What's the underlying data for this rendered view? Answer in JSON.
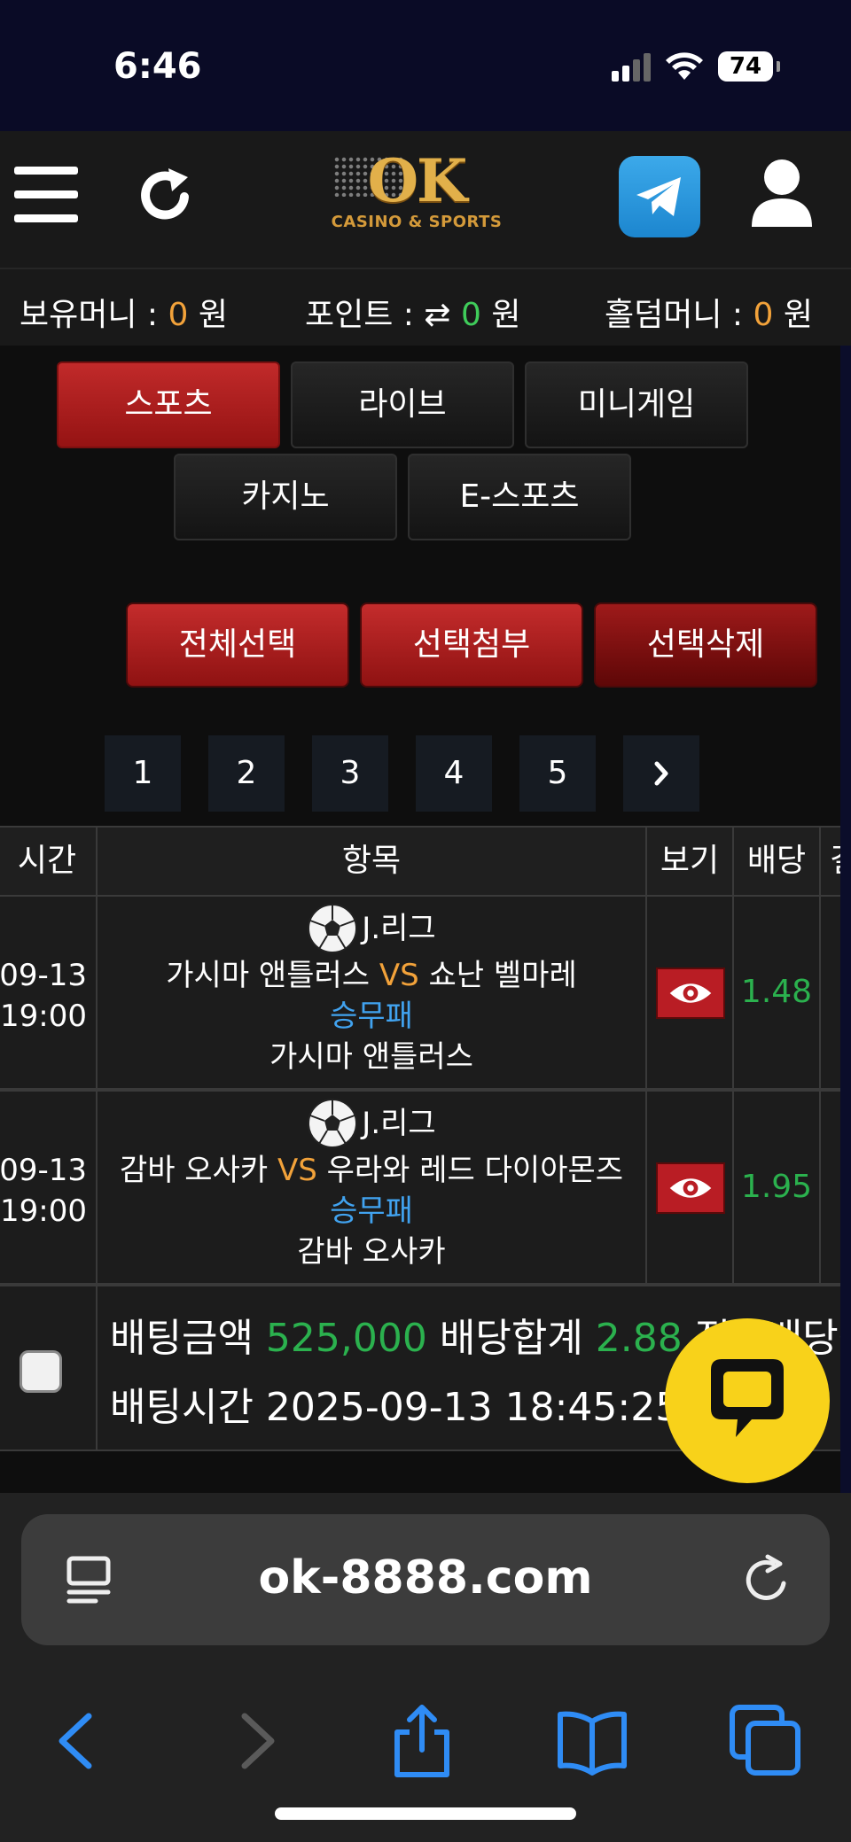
{
  "status": {
    "time": "6:46",
    "battery": "74"
  },
  "header": {
    "logo_main": "OK",
    "logo_sub": "CASINO & SPORTS"
  },
  "balance": {
    "money_label": "보유머니 :",
    "money_value": "0",
    "point_label": "포인트 :",
    "point_value": "0",
    "holdem_label": "홀덤머니 :",
    "holdem_value": "0",
    "unit": "원"
  },
  "categories": [
    "스포츠",
    "라이브",
    "미니게임",
    "카지노",
    "E-스포츠"
  ],
  "actions": {
    "select_all": "전체선택",
    "attach": "선택첨부",
    "delete": "선택삭제"
  },
  "pagination": [
    "1",
    "2",
    "3",
    "4",
    "5"
  ],
  "table": {
    "headers": [
      "시간",
      "항목",
      "보기",
      "배당",
      "결"
    ],
    "rows": [
      {
        "date": "09-13",
        "time": "19:00",
        "league": "J.리그",
        "home": "가시마 앤틀러스",
        "vs": "VS",
        "away": "쇼난 벨마레",
        "bet_type": "승무패",
        "pick": "가시마 앤틀러스",
        "odds": "1.48"
      },
      {
        "date": "09-13",
        "time": "19:00",
        "league": "J.리그",
        "home": "감바 오사카",
        "vs": "VS",
        "away": "우라와 레드 다이아몬즈",
        "bet_type": "승무패",
        "pick": "감바 오사카",
        "odds": "1.95"
      }
    ]
  },
  "summary": {
    "amount_label": "배팅금액",
    "amount_value": "525,000",
    "odds_label": "배당합계",
    "odds_value": "2.88",
    "extra_label": "적중배당참",
    "time_label": "배팅시간",
    "time_value": "2025-09-13 18:45:25"
  },
  "browser": {
    "url": "ok-8888.com"
  },
  "colors": {
    "accent_red": "#b91d24",
    "orange": "#f2a23a",
    "green": "#2bb14e",
    "blue": "#41a3f0",
    "chat_yellow": "#f8d21a"
  }
}
